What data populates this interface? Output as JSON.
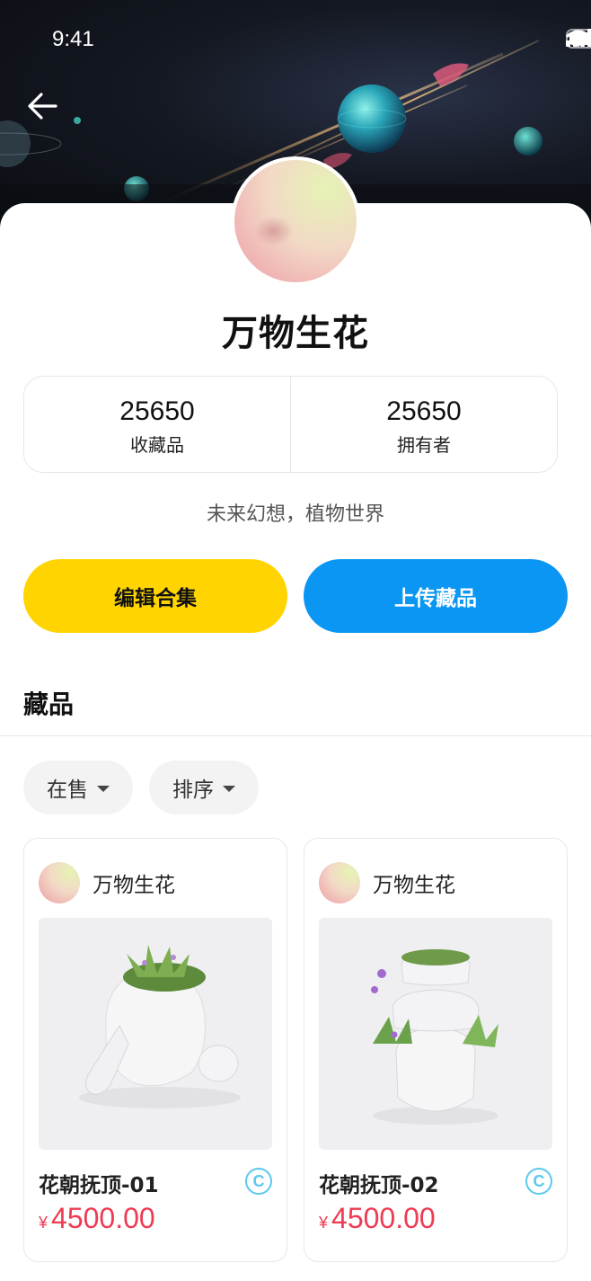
{
  "status": {
    "time": "9:41"
  },
  "collection": {
    "name": "万物生花",
    "description": "未来幻想，植物世界",
    "stats": [
      {
        "value": "25650",
        "label": "收藏品"
      },
      {
        "value": "25650",
        "label": "拥有者"
      }
    ]
  },
  "actions": {
    "edit_label": "编辑合集",
    "upload_label": "上传藏品"
  },
  "section": {
    "title": "藏品"
  },
  "filters": {
    "on_sale": "在售",
    "sort": "排序"
  },
  "items": [
    {
      "owner": "万物生花",
      "name": "花朝抚顶-01",
      "currency": "¥",
      "price": "4500.00"
    },
    {
      "owner": "万物生花",
      "name": "花朝抚顶-02",
      "currency": "¥",
      "price": "4500.00"
    }
  ],
  "colors": {
    "edit_button": "#ffd400",
    "upload_button": "#0a96f2",
    "price": "#ef3b52",
    "coin": "#5ac8f0"
  },
  "icons": [
    "back-arrow-icon",
    "signal-icon",
    "wifi-icon",
    "battery-icon",
    "dropdown-caret-icon",
    "coin-icon"
  ]
}
